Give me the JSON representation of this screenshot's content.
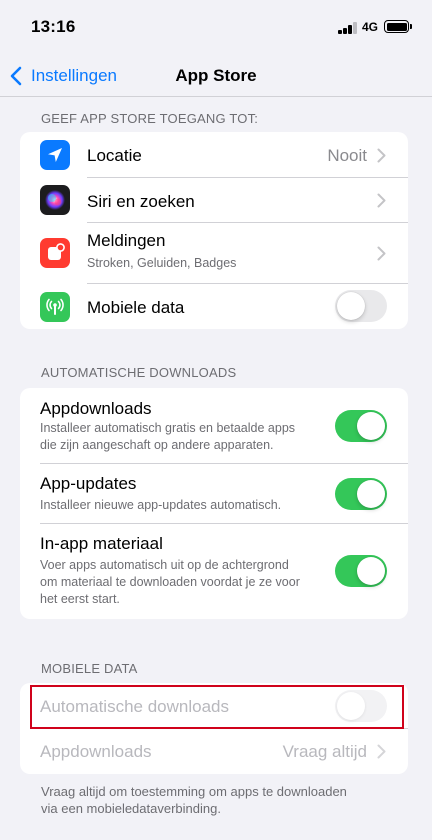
{
  "status": {
    "time": "13:16",
    "network": "4G"
  },
  "nav": {
    "back_label": "Instellingen",
    "title": "App Store"
  },
  "access_section": {
    "header": "GEEF APP STORE TOEGANG TOT:",
    "items": [
      {
        "icon": "location-arrow-icon",
        "color": "#0a7aff",
        "title": "Locatie",
        "value": "Nooit"
      },
      {
        "icon": "siri-icon",
        "color": "#1c1c1e",
        "title": "Siri en zoeken"
      },
      {
        "icon": "notifications-icon",
        "color": "#ff3b30",
        "title": "Meldingen",
        "subtitle": "Stroken, Geluiden, Badges"
      },
      {
        "icon": "antenna-icon",
        "color": "#34c759",
        "title": "Mobiele data",
        "toggle": "off"
      }
    ]
  },
  "auto_section": {
    "header": "AUTOMATISCHE DOWNLOADS",
    "items": [
      {
        "title": "Appdownloads",
        "subtitle_lines": [
          "Installeer automatisch gratis en betaalde apps",
          "die zijn aangeschaft op andere apparaten."
        ],
        "toggle": "on"
      },
      {
        "title": "App-updates",
        "subtitle_lines": [
          "Installeer nieuwe app-updates automatisch."
        ],
        "toggle": "on"
      },
      {
        "title": "In-app materiaal",
        "subtitle_lines": [
          "Voer apps automatisch uit op de achtergrond",
          "om materiaal te downloaden voordat je ze voor",
          "het eerst start."
        ],
        "toggle": "on"
      }
    ]
  },
  "mobile_section": {
    "header": "MOBIELE DATA",
    "items": [
      {
        "title": "Automatische downloads",
        "toggle": "off",
        "disabled": true
      },
      {
        "title": "Appdownloads",
        "value": "Vraag altijd",
        "disabled": true
      }
    ],
    "footer_lines": [
      "Vraag altijd om toestemming om apps te downloaden",
      "via een mobieledataverbinding."
    ]
  },
  "colors": {
    "accent": "#0a7aff",
    "toggle_on": "#34c759",
    "highlight": "#d0021b"
  }
}
